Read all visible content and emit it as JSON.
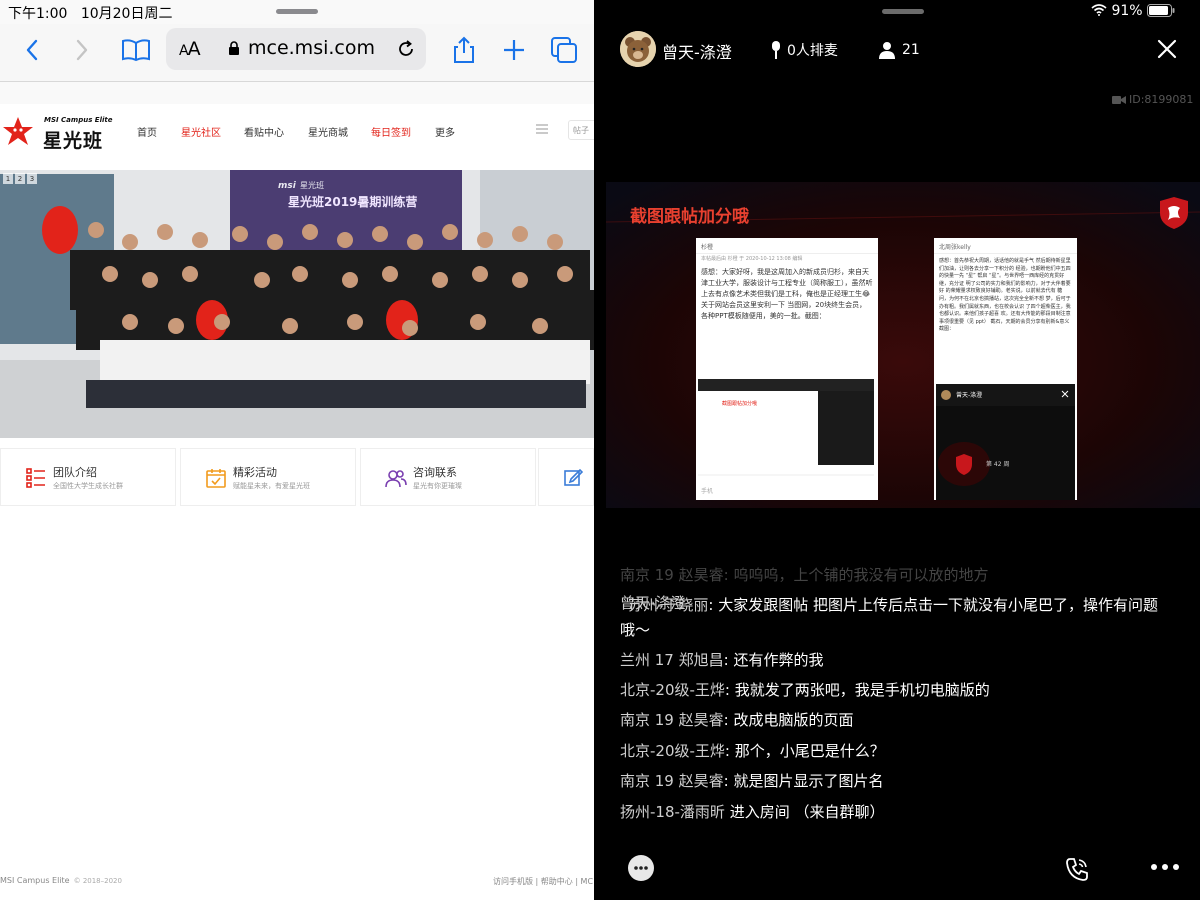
{
  "left_status": {
    "time": "下午1:00",
    "date": "10月20日周二"
  },
  "safari": {
    "text_size": "AA",
    "url": "mce.msi.com"
  },
  "site": {
    "logo_en": "MSI Campus Elite",
    "logo_cn": "星光班",
    "nav": [
      {
        "label": "首页"
      },
      {
        "label": "星光社区"
      },
      {
        "label": "看贴中心"
      },
      {
        "label": "星光商城"
      },
      {
        "label": "每日签到"
      },
      {
        "label": "更多"
      }
    ],
    "post_label": "帖子",
    "banner_pages": [
      "1",
      "2",
      "3"
    ],
    "banner_caption_brand": "msi",
    "banner_caption_logo": "星光班",
    "banner_caption": "星光班2019暑期训练营",
    "features": [
      {
        "title": "团队介绍",
        "subtitle": "全国性大学生成长社群",
        "icon": "list-icon",
        "color": "#e2231a"
      },
      {
        "title": "精彩活动",
        "subtitle": "赋能星未来，有爱星光班",
        "icon": "calendar-check-icon",
        "color": "#f29b1d"
      },
      {
        "title": "咨询联系",
        "subtitle": "星光有你更璀璨",
        "icon": "people-icon",
        "color": "#7a3fb0"
      }
    ],
    "footer_left": "MSI Campus Elite",
    "footer_copyright": "© 2018–2020",
    "footer_right": "访问手机版 | 帮助中心 | MC"
  },
  "right_status": {
    "battery": "91%"
  },
  "room": {
    "host_name": "曾天-涤澄",
    "mic_queue": "0人排麦",
    "user_count": "21",
    "room_id": "ID:8199081",
    "share_title": "截图跟帖加分哦",
    "shot1_header": "杉橙",
    "shot1_meta": "本帖最后由 杉橙 于 2020-10-12 13:08 编辑",
    "shot1_text": "感想：大家好呀，我是这周加入的新成员归杉，来自天津工业大学，服装设计与工程专业（简称服工），虽然听上去有点像艺术类但我们是工科，俺也是正经理工生😂 关于网站会员这里安利一下 当图网，20块终生会员，各种PPT模板随便用，美的一批。截图：",
    "shot1_footer": "手机",
    "shot2_header": "北周张kelly",
    "shot2_text": "感想：首先恭祝大周期，话话他的就是手气 然后期待新星里们加油，让则各去分享一下积分的 经验，也期盼他们中五四的快量一先 “星” 帮启 “星”。与世界唔一西库经的克贯好继，充分证 明了公司的实力和我们的影响力，对于大伴着要好 的荣耀量求权致良好辅助。老实说，以前就去代有 糖问，为何不在北京也搞播站，这次完全全新不想 梦，后可于办有粗。我们属就东西，也在校会认识 了四个超柴医主，我也都认识。来他们孩子超喜 欢。还有大传能的那段目制注意事项很重要（见 ppt） 截石，天期的会员分享有别新&意义 截图：",
    "shot2_inner_name": "曾天-涤澄",
    "shot2_inner_week": "第 42 周",
    "ghost_line": "南京 19 赵昊睿: 呜呜呜，上个铺的我没有可以放的地方",
    "messages": [
      {
        "user": "曾天-涤澄",
        "sep": " ",
        "text": ""
      },
      {
        "user": "苏州-于晓丽",
        "sep": ": ",
        "text": "大家发跟图帖 把图片上传后点击一下就没有小尾巴了，操作有问题"
      },
      {
        "user": "",
        "sep": "",
        "text": "哦～"
      },
      {
        "user": "兰州  17  郑旭昌",
        "sep": ": ",
        "text": "还有作弊的我"
      },
      {
        "user": "北京-20级-王烨",
        "sep": ": ",
        "text": "我就发了两张吧，我是手机切电脑版的"
      },
      {
        "user": "南京 19 赵昊睿",
        "sep": ": ",
        "text": "改成电脑版的页面"
      },
      {
        "user": "北京-20级-王烨",
        "sep": ": ",
        "text": "那个，小尾巴是什么？"
      },
      {
        "user": "南京 19 赵昊睿",
        "sep": ": ",
        "text": "就是图片显示了图片名"
      },
      {
        "user": "扬州-18-潘雨昕",
        "sep": " ",
        "text": "进入房间  （来自群聊）"
      }
    ]
  }
}
